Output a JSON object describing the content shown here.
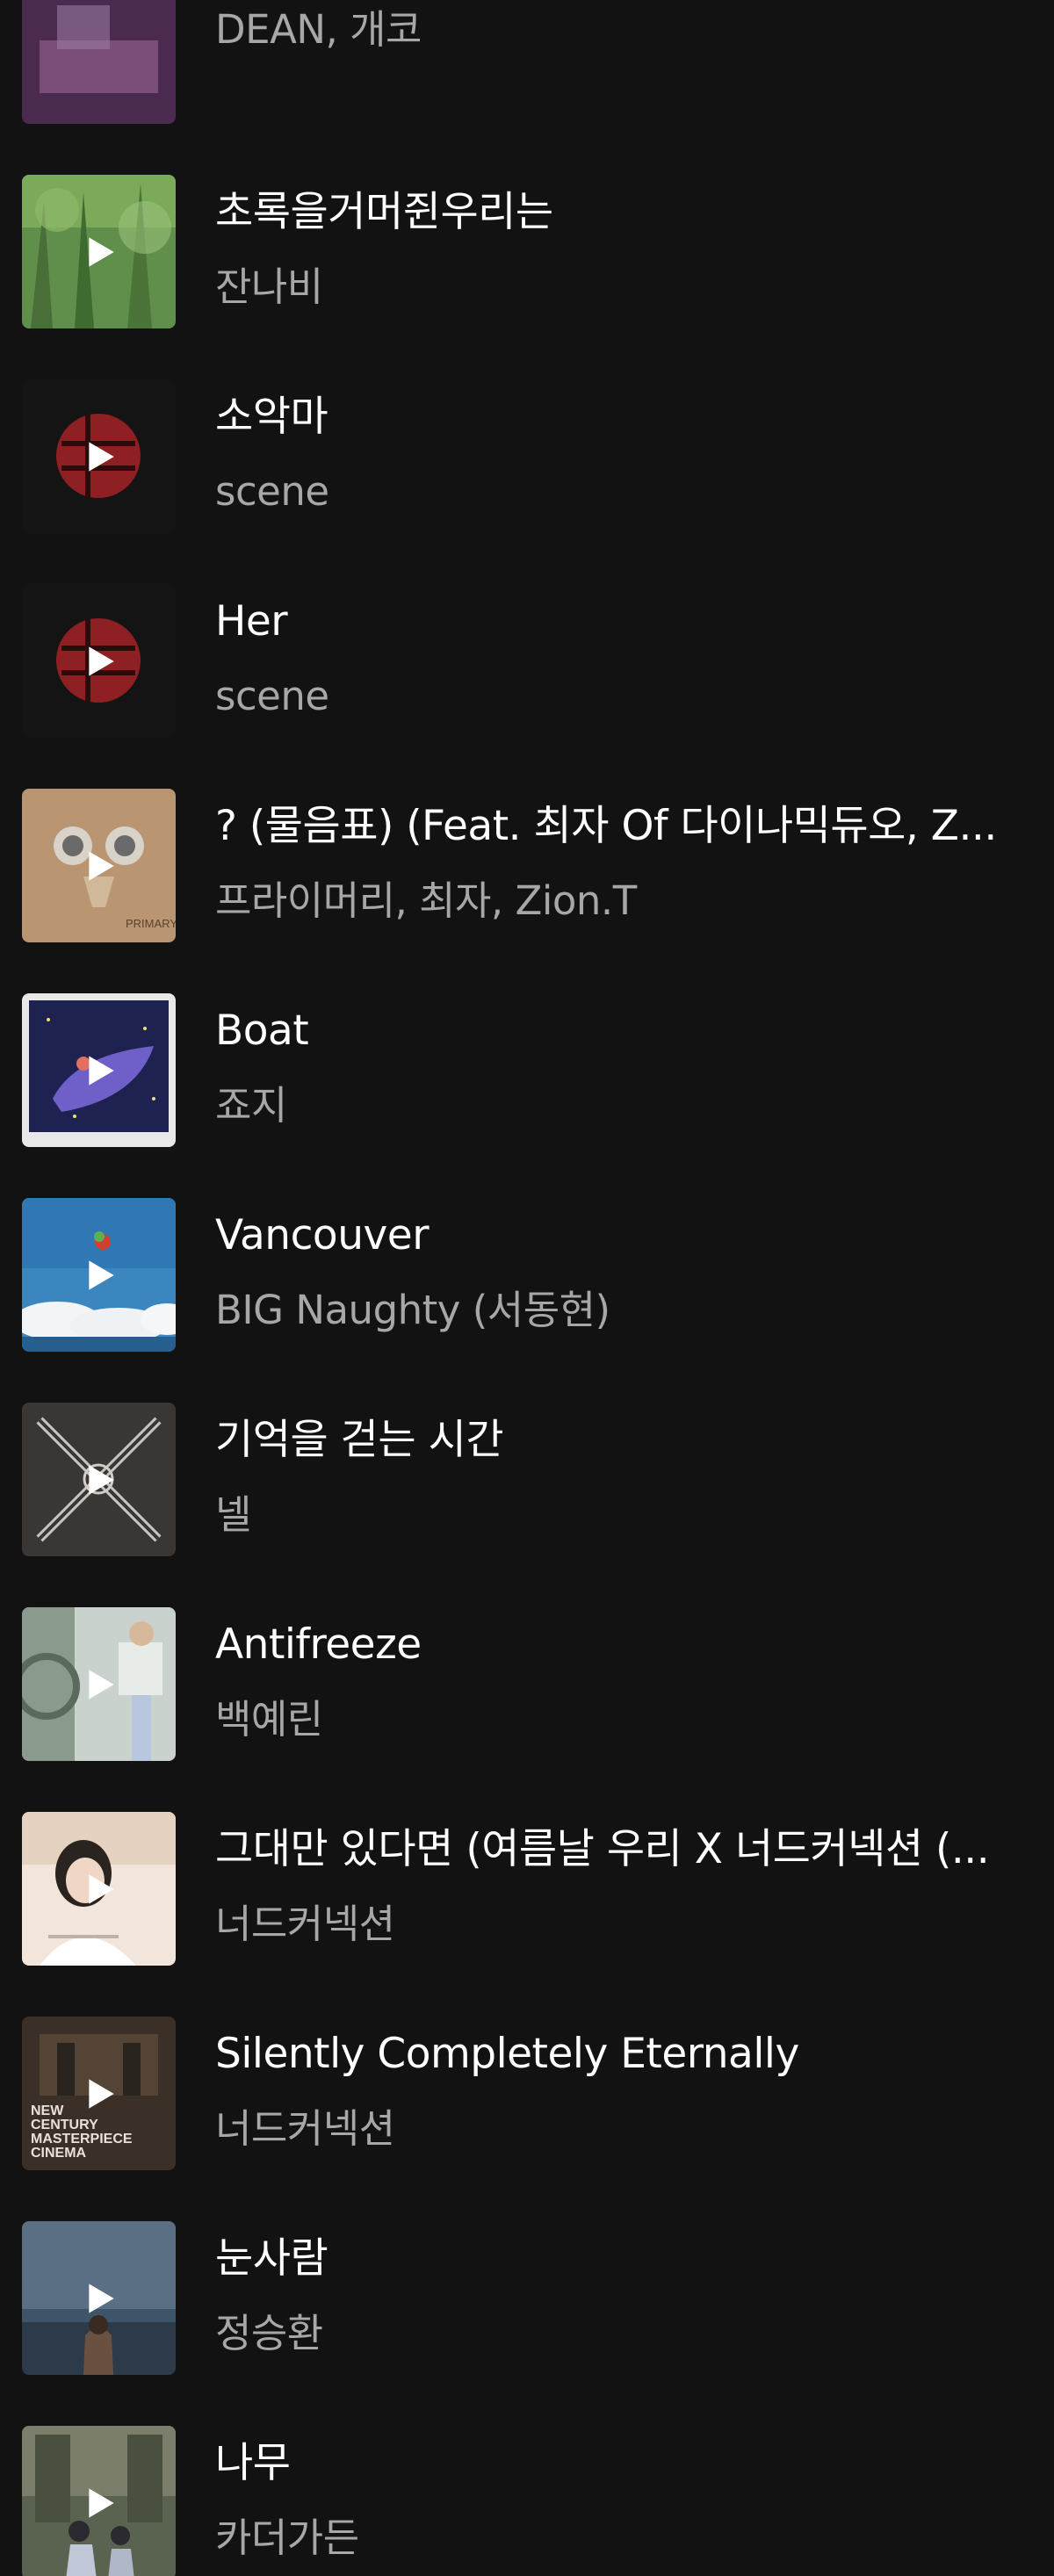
{
  "tracks": [
    {
      "title": "",
      "artist": "DEAN, 개코",
      "cover": "purple-piano"
    },
    {
      "title": "초록을거머쥔우리는",
      "artist": "잔나비",
      "cover": "green-forest"
    },
    {
      "title": "소악마",
      "artist": "scene",
      "cover": "dark-red-sphere"
    },
    {
      "title": "Her",
      "artist": "scene",
      "cover": "dark-red-sphere"
    },
    {
      "title": "? (물음표) (Feat. 최자 Of 다이나믹듀오, Z...",
      "artist": "프라이머리, 최자, Zion.T",
      "cover": "cardboard-robot"
    },
    {
      "title": "Boat",
      "artist": "죠지",
      "cover": "purple-boat"
    },
    {
      "title": "Vancouver",
      "artist": "BIG Naughty (서동현)",
      "cover": "sky-clouds"
    },
    {
      "title": "기억을 걷는 시간",
      "artist": "넬",
      "cover": "crossed-x"
    },
    {
      "title": "Antifreeze",
      "artist": "백예린",
      "cover": "street-photo"
    },
    {
      "title": "그대만 있다면 (여름날 우리 X 너드커넥션 (...",
      "artist": "너드커넥션",
      "cover": "portrait-girl"
    },
    {
      "title": "Silently Completely Eternally",
      "artist": "너드커넥션",
      "cover": "cinema-text"
    },
    {
      "title": "눈사람",
      "artist": "정승환",
      "cover": "sea-person"
    },
    {
      "title": "나무",
      "artist": "카더가든",
      "cover": "two-people"
    }
  ],
  "cover_text": {
    "primary": "PRIMARY",
    "cinema": [
      "NEW",
      "CENTURY",
      "MASTERPIECE",
      "CINEMA"
    ]
  }
}
